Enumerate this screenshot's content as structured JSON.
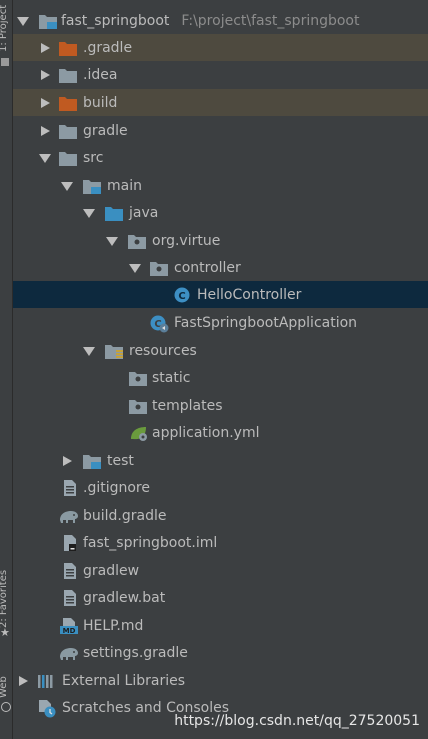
{
  "side_strip": {
    "top_label": "1: Project",
    "middle_label": "2: Favorites",
    "bottom_label": "Web"
  },
  "tree": {
    "root": {
      "name": "fast_springboot",
      "path": "F:\\project\\fast_springboot"
    },
    "items": {
      "gradle_hidden": ".gradle",
      "idea": ".idea",
      "build": "build",
      "gradle": "gradle",
      "src": "src",
      "main": "main",
      "java": "java",
      "org_virtue": "org.virtue",
      "controller": "controller",
      "hello_controller": "HelloController",
      "fast_app": "FastSpringbootApplication",
      "resources": "resources",
      "static": "static",
      "templates": "templates",
      "application_yml": "application.yml",
      "test": "test",
      "gitignore": ".gitignore",
      "build_gradle": "build.gradle",
      "iml": "fast_springboot.iml",
      "gradlew": "gradlew",
      "gradlew_bat": "gradlew.bat",
      "help_md": "HELP.md",
      "settings_gradle": "settings.gradle",
      "external_libraries": "External Libraries",
      "scratches": "Scratches and Consoles"
    }
  },
  "watermark": "https://blog.csdn.net/qq_27520051",
  "colors": {
    "background": "#3c3f41",
    "highlight_row": "#4e4a3f",
    "selected_row": "#0d293e",
    "folder_gray": "#8c9aa3",
    "folder_orange": "#c05a21",
    "source_blue": "#3a8fc1",
    "class_icon": "#3d8fc4",
    "spring_green": "#6a9b3d"
  }
}
